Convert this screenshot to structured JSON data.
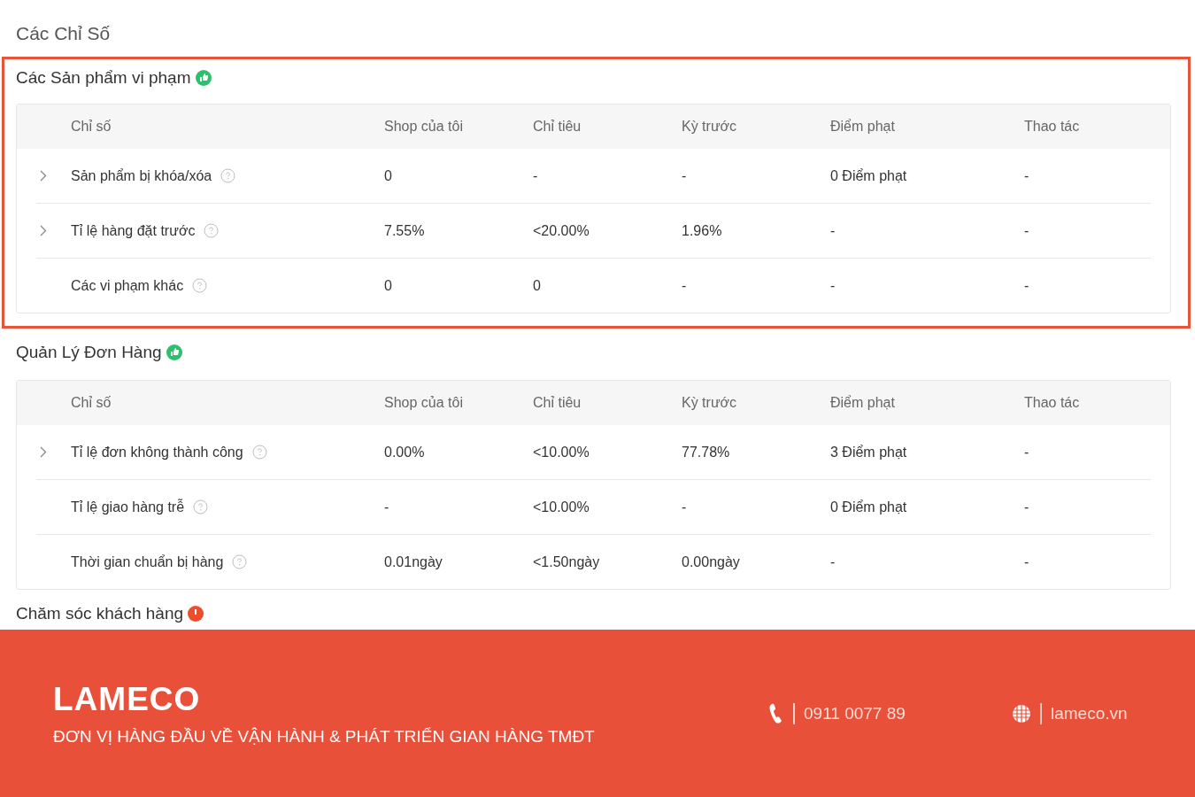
{
  "page_title": "Các Chỉ Số",
  "sections": [
    {
      "title": "Các Sản phẩm vi phạm",
      "color": "#2dbf6c",
      "highlighted": true,
      "columns": [
        "Chỉ số",
        "Shop của tôi",
        "Chỉ tiêu",
        "Kỳ trước",
        "Điểm phạt",
        "Thao tác"
      ],
      "rows": [
        {
          "expandable": true,
          "cells": [
            "Sản phẩm bị khóa/xóa",
            "0",
            "-",
            "-",
            "0 Điểm phạt",
            "-"
          ]
        },
        {
          "expandable": true,
          "cells": [
            "Tỉ lệ hàng đặt trước",
            "7.55%",
            "<20.00%",
            "1.96%",
            "-",
            "-"
          ]
        },
        {
          "expandable": false,
          "cells": [
            "Các vi phạm khác",
            "0",
            "0",
            "-",
            "-",
            "-"
          ]
        }
      ]
    },
    {
      "title": "Quản Lý Đơn Hàng",
      "color": "#2dbf6c",
      "highlighted": false,
      "columns": [
        "Chỉ số",
        "Shop của tôi",
        "Chỉ tiêu",
        "Kỳ trước",
        "Điểm phạt",
        "Thao tác"
      ],
      "rows": [
        {
          "expandable": true,
          "cells": [
            "Tỉ lệ đơn không thành công",
            "0.00%",
            "<10.00%",
            "77.78%",
            "3 Điểm phạt",
            "-"
          ]
        },
        {
          "expandable": false,
          "cells": [
            "Tỉ lệ giao hàng trễ",
            "-",
            "<10.00%",
            "-",
            "0 Điểm phạt",
            "-"
          ]
        },
        {
          "expandable": false,
          "cells": [
            "Thời gian chuẩn bị hàng",
            "0.01ngày",
            "<1.50ngày",
            "0.00ngày",
            "-",
            "-"
          ]
        }
      ]
    },
    {
      "title": "Chăm sóc khách hàng",
      "color": "#ee4d2d",
      "highlighted": false
    }
  ],
  "banner": {
    "brand": "LAMECO",
    "tagline": "ĐƠN VỊ HÀNG ĐẦU VỀ VẬN HÀNH & PHÁT TRIỂN GIAN HÀNG TMĐT",
    "phone": "0911 0077 89",
    "website": "lameco.vn"
  }
}
